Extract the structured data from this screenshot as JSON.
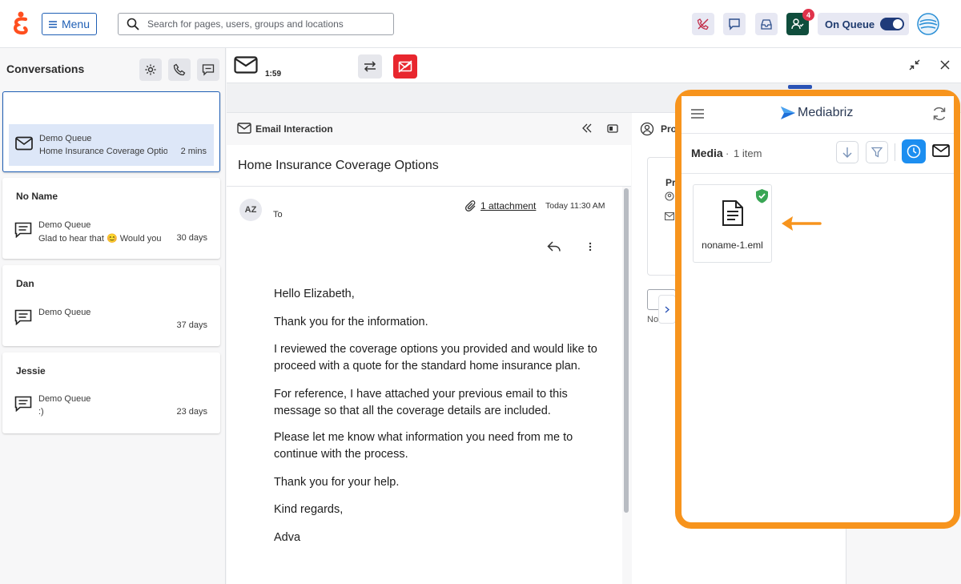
{
  "topbar": {
    "menu_label": "Menu",
    "search_placeholder": "Search for pages, users, groups and locations",
    "notification_count": "4",
    "on_queue_label": "On Queue",
    "on_queue_enabled": true
  },
  "conversations": {
    "title": "Conversations",
    "items": [
      {
        "name": "",
        "queue": "Demo Queue",
        "preview": "Home Insurance Coverage Optio",
        "time": "2 mins",
        "icon": "envelope-icon",
        "selected": true
      },
      {
        "name": "No Name",
        "queue": "Demo Queue",
        "preview": "Glad to hear that 😊 Would you",
        "time": "30 days",
        "icon": "message-icon",
        "selected": false
      },
      {
        "name": "Dan",
        "queue": "Demo Queue",
        "preview": "",
        "time": "37 days",
        "icon": "message-icon",
        "selected": false
      },
      {
        "name": "Jessie",
        "queue": "Demo Queue",
        "preview": ":)",
        "time": "23 days",
        "icon": "message-icon",
        "selected": false
      }
    ]
  },
  "interaction": {
    "timer": "1:59"
  },
  "email": {
    "panel_title": "Email Interaction",
    "subject": "Home Insurance Coverage Options",
    "sender_initials": "AZ",
    "to_label": "To",
    "attachment_label": "1 attachment",
    "timestamp": "Today 11:30 AM",
    "body": [
      "Hello Elizabeth,",
      "Thank you for the information.",
      "I reviewed the coverage options you provided and would like to proceed with a quote for the standard home insurance plan.",
      "For reference, I have attached your previous email to this message so that all the coverage details are included.",
      "Please let me know what information you need from me to continue with the process.",
      "Thank you for your help.",
      "Kind regards,",
      "Adva"
    ]
  },
  "profile": {
    "tab_label": "Pro",
    "card_label": "Pr",
    "footer_fragment": "No"
  },
  "mediabriz": {
    "brand": "Mediabriz",
    "section_title": "Media",
    "item_count": "1 item",
    "file_name": "noname-1.eml"
  },
  "colors": {
    "accent_blue": "#1f5fb5",
    "highlight_orange": "#f7941d",
    "alert_red": "#e0334b",
    "selected_row": "#dde7f8",
    "verified_green": "#3aa655"
  }
}
